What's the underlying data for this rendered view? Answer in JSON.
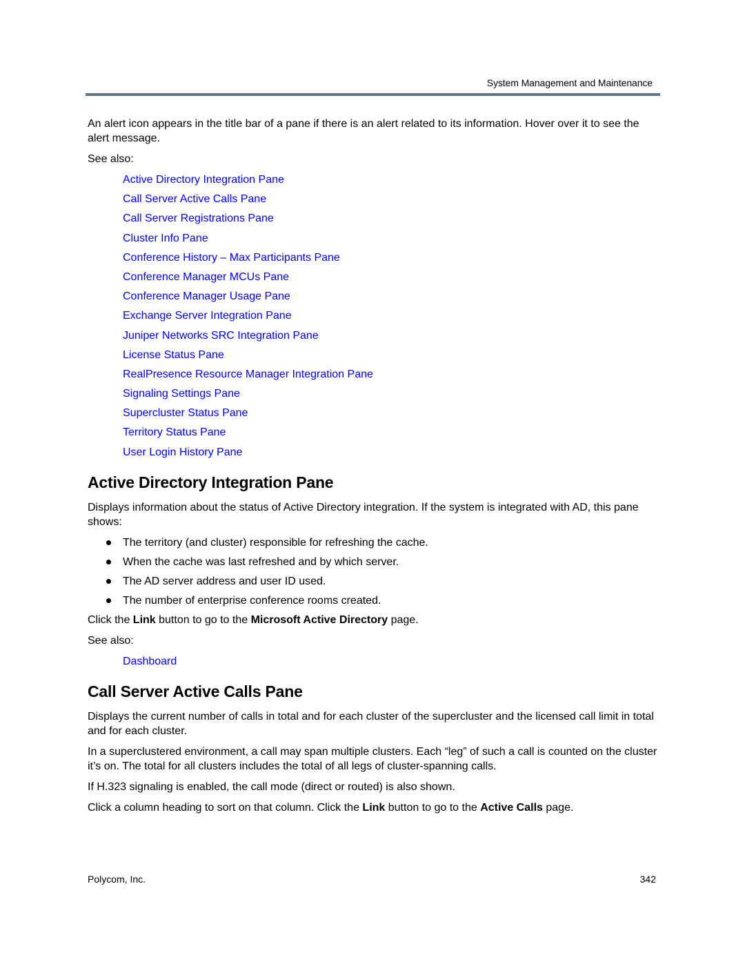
{
  "header": {
    "title": "System Management and Maintenance",
    "rule_color": "#5e7585"
  },
  "intro": {
    "paragraph": "An alert icon appears in the title bar of a pane if there is an alert related to its information. Hover over it to see the alert message.",
    "see_also_label": "See also:",
    "links": [
      "Active Directory Integration Pane",
      "Call Server Active Calls Pane",
      "Call Server Registrations Pane",
      "Cluster Info Pane",
      "Conference History – Max Participants Pane",
      "Conference Manager MCUs Pane",
      "Conference Manager Usage Pane",
      "Exchange Server Integration Pane",
      "Juniper Networks SRC Integration Pane",
      "License Status Pane",
      "RealPresence Resource Manager Integration Pane",
      "Signaling Settings Pane",
      "Supercluster Status Pane",
      "Territory Status Pane",
      "User Login History Pane"
    ]
  },
  "section_ad": {
    "heading": "Active Directory Integration Pane",
    "paragraph": "Displays information about the status of Active Directory integration. If the system is integrated with AD, this pane shows:",
    "bullets": [
      "The territory (and cluster) responsible for refreshing the cache.",
      "When the cache was last refreshed and by which server.",
      "The AD server address and user ID used.",
      "The number of enterprise conference rooms created."
    ],
    "click_text": {
      "pre": "Click the ",
      "bold1": "Link",
      "mid": " button to go to the ",
      "bold2": "Microsoft Active Directory",
      "post": " page."
    },
    "see_also_label": "See also:",
    "links": [
      "Dashboard"
    ]
  },
  "section_calls": {
    "heading": "Call Server Active Calls Pane",
    "paragraphs": [
      "Displays the current number of calls in total and for each cluster of the supercluster and the licensed call limit in total and for each cluster.",
      "In a superclustered environment, a call may span multiple clusters. Each “leg” of such a call is counted on the cluster it’s on. The total for all clusters includes the total of all legs of cluster-spanning calls.",
      "If H.323 signaling is enabled, the call mode (direct or routed) is also shown."
    ],
    "click_text": {
      "pre": "Click a column heading to sort on that column. Click the ",
      "bold1": "Link",
      "mid": " button to go to the ",
      "bold2": "Active Calls",
      "post": " page."
    }
  },
  "footer": {
    "company": "Polycom, Inc.",
    "page_number": "342"
  }
}
